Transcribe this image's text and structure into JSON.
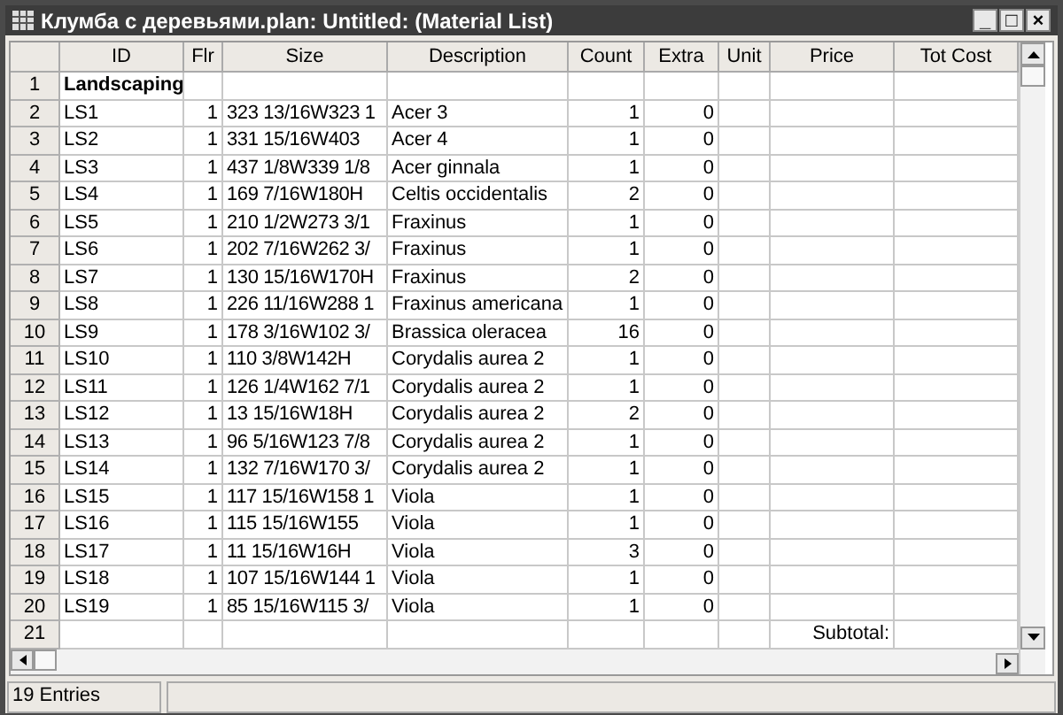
{
  "window": {
    "title": "Клумба с деревьями.plan: Untitled: (Material List)",
    "controls": [
      "_",
      "□",
      "×"
    ]
  },
  "table": {
    "columns": [
      "ID",
      "Flr",
      "Size",
      "Description",
      "Count",
      "Extra",
      "Unit",
      "Price",
      "Tot Cost"
    ],
    "rows": [
      {
        "kind": "category",
        "num": "1",
        "id": "Landscaping"
      },
      {
        "kind": "item",
        "num": "2",
        "id": "LS1",
        "flr": "1",
        "size": "323 13/16W323 1",
        "description": "Acer 3",
        "count": "1",
        "extra": "0"
      },
      {
        "kind": "item",
        "num": "3",
        "id": "LS2",
        "flr": "1",
        "size": "331 15/16W403",
        "description": "Acer 4",
        "count": "1",
        "extra": "0"
      },
      {
        "kind": "item",
        "num": "4",
        "id": "LS3",
        "flr": "1",
        "size": "437 1/8W339 1/8",
        "description": "Acer ginnala",
        "count": "1",
        "extra": "0"
      },
      {
        "kind": "item",
        "num": "5",
        "id": "LS4",
        "flr": "1",
        "size": "169 7/16W180H",
        "description": "Celtis occidentalis",
        "count": "2",
        "extra": "0"
      },
      {
        "kind": "item",
        "num": "6",
        "id": "LS5",
        "flr": "1",
        "size": "210 1/2W273 3/1",
        "description": "Fraxinus",
        "count": "1",
        "extra": "0"
      },
      {
        "kind": "item",
        "num": "7",
        "id": "LS6",
        "flr": "1",
        "size": "202 7/16W262 3/",
        "description": "Fraxinus",
        "count": "1",
        "extra": "0"
      },
      {
        "kind": "item",
        "num": "8",
        "id": "LS7",
        "flr": "1",
        "size": "130 15/16W170H",
        "description": "Fraxinus",
        "count": "2",
        "extra": "0"
      },
      {
        "kind": "item",
        "num": "9",
        "id": "LS8",
        "flr": "1",
        "size": "226 11/16W288 1",
        "description": "Fraxinus americana",
        "count": "1",
        "extra": "0"
      },
      {
        "kind": "item",
        "num": "10",
        "id": "LS9",
        "flr": "1",
        "size": "178 3/16W102 3/",
        "description": "Brassica oleracea",
        "count": "16",
        "extra": "0"
      },
      {
        "kind": "item",
        "num": "11",
        "id": "LS10",
        "flr": "1",
        "size": "110 3/8W142H",
        "description": "Corydalis aurea 2",
        "count": "1",
        "extra": "0"
      },
      {
        "kind": "item",
        "num": "12",
        "id": "LS11",
        "flr": "1",
        "size": "126 1/4W162 7/1",
        "description": "Corydalis aurea 2",
        "count": "1",
        "extra": "0"
      },
      {
        "kind": "item",
        "num": "13",
        "id": "LS12",
        "flr": "1",
        "size": "13 15/16W18H",
        "description": "Corydalis aurea 2",
        "count": "2",
        "extra": "0"
      },
      {
        "kind": "item",
        "num": "14",
        "id": "LS13",
        "flr": "1",
        "size": "96 5/16W123 7/8",
        "description": "Corydalis aurea 2",
        "count": "1",
        "extra": "0"
      },
      {
        "kind": "item",
        "num": "15",
        "id": "LS14",
        "flr": "1",
        "size": "132 7/16W170 3/",
        "description": "Corydalis aurea 2",
        "count": "1",
        "extra": "0"
      },
      {
        "kind": "item",
        "num": "16",
        "id": "LS15",
        "flr": "1",
        "size": "117 15/16W158 1",
        "description": "Viola",
        "count": "1",
        "extra": "0"
      },
      {
        "kind": "item",
        "num": "17",
        "id": "LS16",
        "flr": "1",
        "size": "115 15/16W155",
        "description": "Viola",
        "count": "1",
        "extra": "0"
      },
      {
        "kind": "item",
        "num": "18",
        "id": "LS17",
        "flr": "1",
        "size": "11 15/16W16H",
        "description": "Viola",
        "count": "3",
        "extra": "0"
      },
      {
        "kind": "item",
        "num": "19",
        "id": "LS18",
        "flr": "1",
        "size": "107 15/16W144 1",
        "description": "Viola",
        "count": "1",
        "extra": "0"
      },
      {
        "kind": "item",
        "num": "20",
        "id": "LS19",
        "flr": "1",
        "size": "85 15/16W115 3/",
        "description": "Viola",
        "count": "1",
        "extra": "0"
      },
      {
        "kind": "subtotal",
        "num": "21",
        "label": "Subtotal:"
      }
    ]
  },
  "status_bar": {
    "entries": "19 Entries"
  }
}
